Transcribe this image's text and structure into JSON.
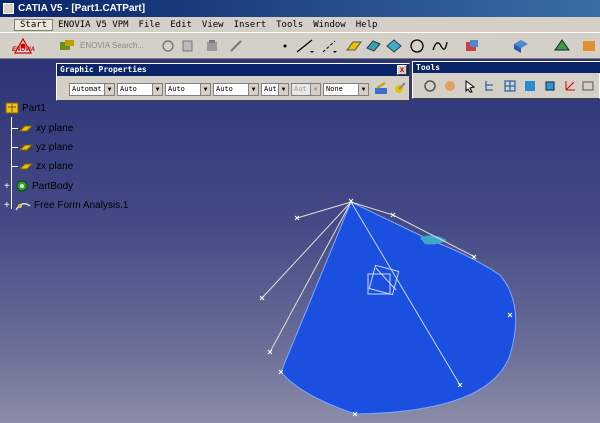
{
  "window": {
    "title": "CATIA V5 - [Part1.CATPart]"
  },
  "menu": {
    "items": [
      "Start",
      "ENOVIA V5 VPM",
      "File",
      "Edit",
      "View",
      "Insert",
      "Tools",
      "Window",
      "Help"
    ]
  },
  "toolbar": {
    "enovia_label": "ENOVIA",
    "enovia_search": "ENOVIA Search..."
  },
  "graphic_properties": {
    "title": "Graphic Properties",
    "close_label": "x",
    "combos": [
      "Automat",
      "Auto",
      "Auto",
      "Auto",
      "Aut",
      "Aut",
      "None"
    ]
  },
  "tools_panel": {
    "title": "Tools"
  },
  "tree": {
    "root": "Part1",
    "items": [
      "xy plane",
      "yz plane",
      "zx plane",
      "PartBody",
      "Free Form Analysis.1"
    ]
  },
  "colors": {
    "cone_blue": "#1a4fe0",
    "cone_highlight": "#3fa8c8",
    "title_bar": "#0a246a",
    "ui_gray": "#d4d0c8"
  }
}
